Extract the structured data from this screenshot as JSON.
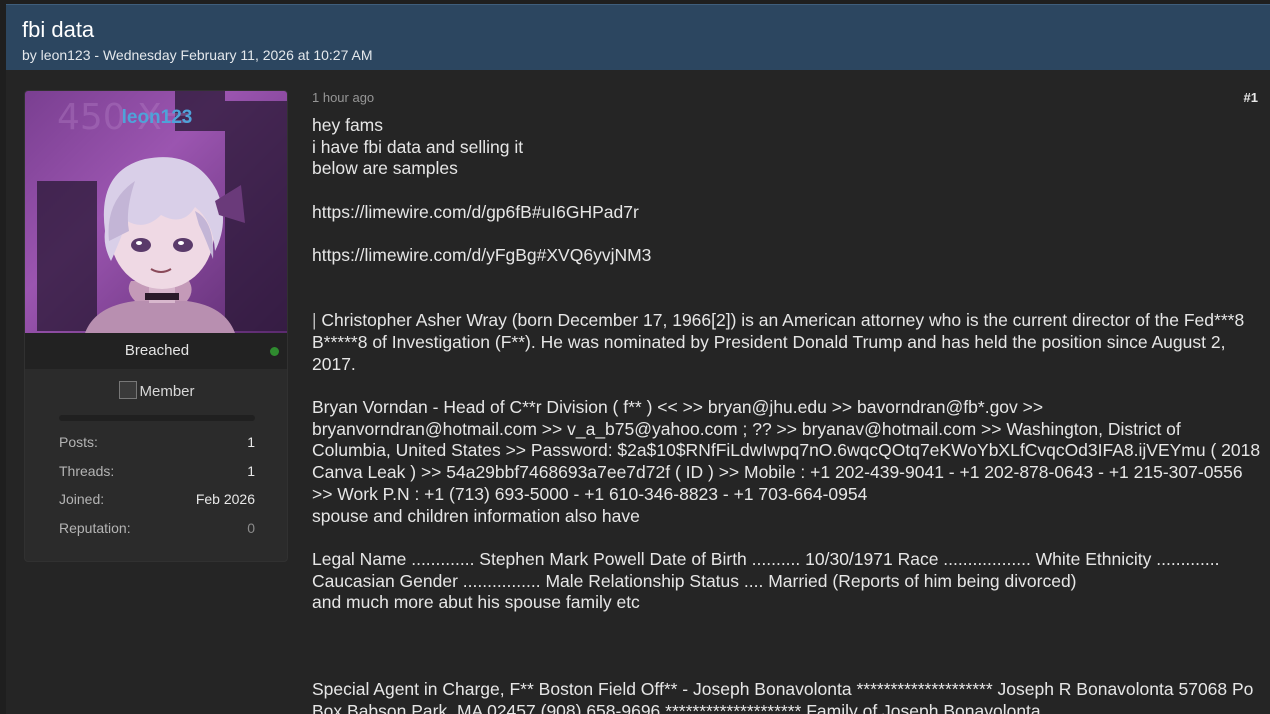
{
  "thread": {
    "title": "fbi data",
    "meta": "by leon123 - Wednesday February 11, 2026 at 10:27 AM"
  },
  "user": {
    "avatar_name": "leon123",
    "username": "Breached",
    "status_color": "#2f8b2f",
    "rank_alt": "Member",
    "stats": [
      {
        "label": "Posts:",
        "value": "1"
      },
      {
        "label": "Threads:",
        "value": "1"
      },
      {
        "label": "Joined:",
        "value": "Feb 2026"
      },
      {
        "label": "Reputation:",
        "value": "0"
      }
    ]
  },
  "post": {
    "time": "1 hour ago",
    "number": "#1",
    "lines": {
      "l1": "hey fams",
      "l2": "i have fbi data and selling it",
      "l3": "below are samples",
      "link1": "https://limewire.com/d/gp6fB#uI6GHPad7r",
      "link2": "https://limewire.com/d/yFgBg#XVQ6yvjNM3",
      "quote_mark": "|",
      "para1": "Christopher Asher Wray (born December 17, 1966[2]) is an American attorney who is the current director of the Fed***8 B*****8 of Investigation (F**). He was nominated by President Donald Trump and has held the position since August 2, 2017.",
      "para2": "Bryan Vorndan - Head of C**r Division ( f** ) << >> bryan@jhu.edu >> bavorndran@fb*.gov >> bryanvorndran@hotmail.com >> v_a_b75@yahoo.com ; ?? >> bryanav@hotmail.com >> Washington, District of Columbia, United States >> Password: $2a$10$RNfFiLdwIwpq7nO.6wqcQOtq7eKWoYbXLfCvqcOd3IFA8.ijVEYmu ( 2018 Canva Leak ) >> 54a29bbf7468693a7ee7d72f ( ID ) >> Mobile : +1 202-439-9041 - +1 202-878-0643 - +1 215-307-0556 >> Work P.N : +1 (713) 693-5000 - +1 610-346-8823 - +1 703-664-0954",
      "para2b": "spouse and children information also have",
      "para3": "Legal Name ............. Stephen Mark Powell Date of Birth .......... 10/30/1971 Race .................. White Ethnicity ............. Caucasian Gender ................ Male Relationship Status .... Married (Reports of him being divorced)",
      "para3b": "and much more abut his spouse family etc",
      "para4": "Special Agent in Charge, F** Boston Field Off** - Joseph Bonavolonta ******************** Joseph R Bonavolonta 57068 Po Box Babson Park, MA 02457 (908) 658-9696 ******************** Family of Joseph Bonavolonta"
    }
  }
}
